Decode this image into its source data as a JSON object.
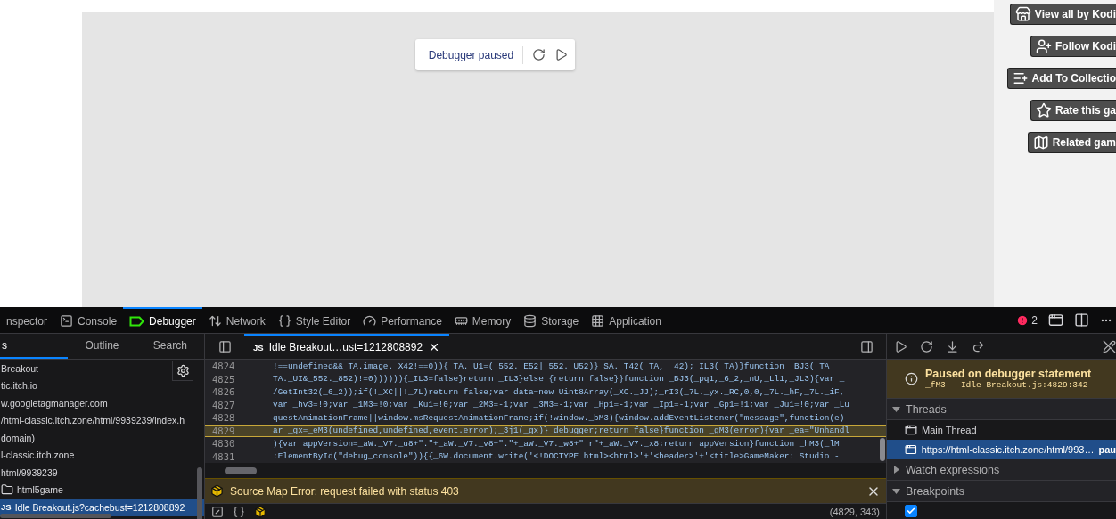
{
  "page": {
    "pause_overlay": {
      "label": "Debugger paused"
    },
    "actions": [
      {
        "kind": "store",
        "label": "View all by Kodi"
      },
      {
        "kind": "follow",
        "label": "Follow Kodi"
      },
      {
        "kind": "collection",
        "label": "Add To Collectio"
      },
      {
        "kind": "rate",
        "label": "Rate this ga"
      },
      {
        "kind": "related",
        "label": "Related gam"
      }
    ]
  },
  "devtools": {
    "tabs": [
      {
        "kind": "inspector",
        "label": "nspector",
        "selected": false
      },
      {
        "kind": "console",
        "label": "Console",
        "selected": false
      },
      {
        "kind": "debugger",
        "label": "Debugger",
        "selected": true
      },
      {
        "kind": "network",
        "label": "Network",
        "selected": false
      },
      {
        "kind": "style",
        "label": "Style Editor",
        "selected": false
      },
      {
        "kind": "performance",
        "label": "Performance",
        "selected": false
      },
      {
        "kind": "memory",
        "label": "Memory",
        "selected": false
      },
      {
        "kind": "storage",
        "label": "Storage",
        "selected": false
      },
      {
        "kind": "application",
        "label": "Application",
        "selected": false
      }
    ],
    "error_count": "2",
    "sources": {
      "tabs": [
        {
          "label": "s",
          "selected": true
        },
        {
          "label": "Outline",
          "selected": false
        },
        {
          "label": "Search",
          "selected": false
        }
      ],
      "tree": [
        {
          "kind": "host",
          "label": "Breakout",
          "selected": false
        },
        {
          "kind": "host",
          "label": "tic.itch.io",
          "selected": false
        },
        {
          "kind": "host",
          "label": "w.googletagmanager.com",
          "selected": false
        },
        {
          "kind": "host",
          "label": "/html-classic.itch.zone/html/9939239/index.h",
          "selected": false
        },
        {
          "kind": "host",
          "label": "domain)",
          "selected": false
        },
        {
          "kind": "host",
          "label": "l-classic.itch.zone",
          "selected": false
        },
        {
          "kind": "host",
          "label": "html/9939239",
          "selected": false
        },
        {
          "kind": "folder",
          "label": "html5game",
          "selected": false
        },
        {
          "kind": "file",
          "type": "JS",
          "label": "Idle Breakout.js?cachebust=1212808892",
          "selected": true
        }
      ]
    },
    "editor": {
      "tab": {
        "type": "JS",
        "label": "Idle Breakout…ust=1212808892"
      },
      "lines": [
        {
          "number": "4824",
          "code": "!==undefined&&_TA.image._X42!==0)){_TA._U1=(_552._E52|_552._U52)}_SA._T42(_TA,__42);_IL3(_TA)}function _BJ3(_TA",
          "paused": false
        },
        {
          "number": "4825",
          "code": "TA._UI&_552._852)!=0)))))){_IL3=false}return _IL3}else {return false}}function _BJ3(_pq1,_6_2,_nU,_Ll1,_JL3){var _",
          "paused": false
        },
        {
          "number": "4826",
          "code": "/GetInt32(_6_2));if(!_XC||!_7L)return false;var data=new Uint8Array(_XC._JJ);_rI3(_7L._yx._RC,0,0,_7L._hF,_7L._iF,",
          "paused": false
        },
        {
          "number": "4827",
          "code": "var _hv3=!0;var _1M3=!0;var _Ku1=!0;var _2M3=-1;var _3M3=-1;var _Hp1=-1;var _Ip1=-1;var _Gp1=!1;var _Ju1=!0;var _Lu",
          "paused": false
        },
        {
          "number": "4828",
          "code": "questAnimationFrame||window.msRequestAnimationFrame;if(!window._bM3){window.addEventListener(\"message\",function(e)",
          "paused": false
        },
        {
          "number": "4829",
          "code": "ar _gx=_eM3(undefined,undefined,event.error);_3j1(_gx)} debugger;return false}function _gM3(error){var _ea=\"Unhandl",
          "paused": true
        },
        {
          "number": "4830",
          "code": "){var appVersion=_aW._V7._u8+\".\"+_aW._V7._v8+\".\"+_aW._V7._w8+\" r\"+_aW._V7._x8;return appVersion}function _hM3(_lM",
          "paused": false
        },
        {
          "number": "4831",
          "code": ":ElementById(\"debug_console\")){{_6W.document.write('<!DOCTYPE html><html>'+'<header>'+'<title>GameMaker: Studio - ",
          "paused": false
        }
      ],
      "warning": "Source Map Error: request failed with status 403",
      "position": "(4829, 343)"
    },
    "pause_info": {
      "title": "Paused on debugger statement",
      "location": "_fM3 - Idle Breakout.js:4829:342"
    },
    "threads": {
      "label": "Threads",
      "expanded": true,
      "items": [
        {
          "label": "Main Thread",
          "selected": false
        },
        {
          "label": "https://html-classic.itch.zone/html/993…",
          "status": "pau",
          "selected": true
        }
      ]
    },
    "watch": {
      "label": "Watch expressions",
      "expanded": false
    },
    "breakpoints": {
      "label": "Breakpoints",
      "expanded": true,
      "pause_on_debugger": {
        "checked": true
      }
    }
  }
}
